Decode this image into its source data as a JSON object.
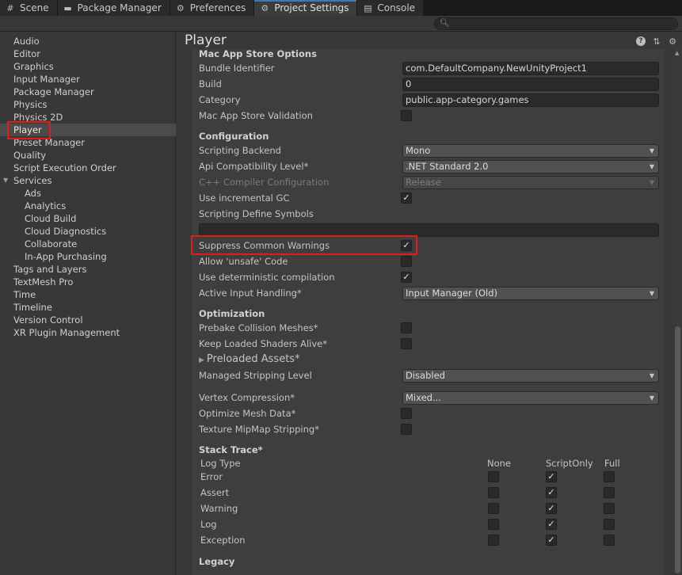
{
  "tabs": [
    {
      "label": "Scene",
      "icon": "grid-icon",
      "active": false
    },
    {
      "label": "Package Manager",
      "icon": "package-icon",
      "active": false
    },
    {
      "label": "Preferences",
      "icon": "gear-icon",
      "active": false
    },
    {
      "label": "Project Settings",
      "icon": "gear-icon",
      "active": true
    },
    {
      "label": "Console",
      "icon": "console-icon",
      "active": false
    }
  ],
  "search": {
    "placeholder": ""
  },
  "sidebar": {
    "items": [
      {
        "label": "Audio"
      },
      {
        "label": "Editor"
      },
      {
        "label": "Graphics"
      },
      {
        "label": "Input Manager"
      },
      {
        "label": "Package Manager"
      },
      {
        "label": "Physics"
      },
      {
        "label": "Physics 2D"
      },
      {
        "label": "Player",
        "selected": true
      },
      {
        "label": "Preset Manager"
      },
      {
        "label": "Quality"
      },
      {
        "label": "Script Execution Order"
      },
      {
        "label": "Services",
        "expanded": true
      },
      {
        "label": "Ads",
        "sub": true
      },
      {
        "label": "Analytics",
        "sub": true
      },
      {
        "label": "Cloud Build",
        "sub": true
      },
      {
        "label": "Cloud Diagnostics",
        "sub": true
      },
      {
        "label": "Collaborate",
        "sub": true
      },
      {
        "label": "In-App Purchasing",
        "sub": true
      },
      {
        "label": "Tags and Layers"
      },
      {
        "label": "TextMesh Pro"
      },
      {
        "label": "Time"
      },
      {
        "label": "Timeline"
      },
      {
        "label": "Version Control"
      },
      {
        "label": "XR Plugin Management"
      }
    ]
  },
  "panel": {
    "title": "Player",
    "mac_app_store": {
      "header": "Mac App Store Options",
      "bundle_identifier_label": "Bundle Identifier",
      "bundle_identifier_value": "com.DefaultCompany.NewUnityProject1",
      "build_label": "Build",
      "build_value": "0",
      "category_label": "Category",
      "category_value": "public.app-category.games",
      "validation_label": "Mac App Store Validation",
      "validation_checked": false
    },
    "configuration": {
      "header": "Configuration",
      "scripting_backend_label": "Scripting Backend",
      "scripting_backend_value": "Mono",
      "api_level_label": "Api Compatibility Level*",
      "api_level_value": ".NET Standard 2.0",
      "cpp_compiler_label": "C++ Compiler Configuration",
      "cpp_compiler_value": "Release",
      "incremental_gc_label": "Use incremental GC",
      "incremental_gc_checked": true,
      "define_symbols_label": "Scripting Define Symbols",
      "define_symbols_value": "",
      "suppress_warnings_label": "Suppress Common Warnings",
      "suppress_warnings_checked": true,
      "allow_unsafe_label": "Allow 'unsafe' Code",
      "allow_unsafe_checked": false,
      "deterministic_label": "Use deterministic compilation",
      "deterministic_checked": true,
      "active_input_label": "Active Input Handling*",
      "active_input_value": "Input Manager (Old)"
    },
    "optimization": {
      "header": "Optimization",
      "prebake_label": "Prebake Collision Meshes*",
      "prebake_checked": false,
      "keep_shaders_label": "Keep Loaded Shaders Alive*",
      "keep_shaders_checked": false,
      "preloaded_assets_label": "Preloaded Assets*",
      "stripping_level_label": "Managed Stripping Level",
      "stripping_level_value": "Disabled",
      "vertex_compression_label": "Vertex Compression*",
      "vertex_compression_value": "Mixed...",
      "optimize_mesh_label": "Optimize Mesh Data*",
      "optimize_mesh_checked": false,
      "mipmap_stripping_label": "Texture MipMap Stripping*",
      "mipmap_stripping_checked": false
    },
    "stack_trace": {
      "header": "Stack Trace*",
      "log_type_label": "Log Type",
      "columns": [
        "None",
        "ScriptOnly",
        "Full"
      ],
      "rows": [
        {
          "label": "Error",
          "checks": [
            false,
            true,
            false
          ]
        },
        {
          "label": "Assert",
          "checks": [
            false,
            true,
            false
          ]
        },
        {
          "label": "Warning",
          "checks": [
            false,
            true,
            false
          ]
        },
        {
          "label": "Log",
          "checks": [
            false,
            true,
            false
          ]
        },
        {
          "label": "Exception",
          "checks": [
            false,
            true,
            false
          ]
        }
      ]
    },
    "legacy": {
      "header": "Legacy"
    }
  },
  "colors": {
    "highlight": "#e01d1d",
    "accent": "#3a79bb"
  }
}
